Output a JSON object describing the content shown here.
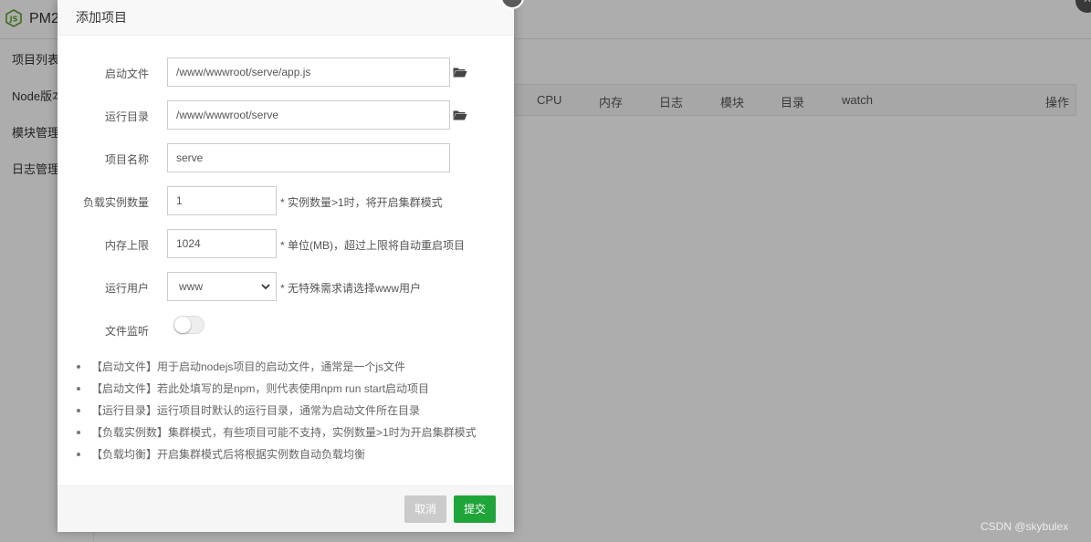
{
  "background": {
    "app_title": "PM2",
    "close_glyph": "×",
    "sidebar": [
      "项目列表",
      "Node版本",
      "模块管理",
      "日志管理"
    ],
    "table_headers": [
      "CPU",
      "内存",
      "日志",
      "模块",
      "目录",
      "watch",
      "操作"
    ]
  },
  "modal": {
    "title": "添加项目",
    "close_glyph": "×",
    "fields": {
      "start_file": {
        "label": "启动文件",
        "value": "/www/wwwroot/serve/app.js"
      },
      "run_dir": {
        "label": "运行目录",
        "value": "/www/wwwroot/serve"
      },
      "project_name": {
        "label": "项目名称",
        "value": "serve"
      },
      "instances": {
        "label": "负载实例数量",
        "value": "1",
        "hint": "* 实例数量>1时，将开启集群模式"
      },
      "memory_limit": {
        "label": "内存上限",
        "value": "1024",
        "hint": "* 单位(MB)，超过上限将自动重启项目"
      },
      "run_user": {
        "label": "运行用户",
        "value": "www",
        "hint": "* 无特殊需求请选择www用户"
      },
      "file_watch": {
        "label": "文件监听",
        "enabled": false
      }
    },
    "notes": [
      "【启动文件】用于启动nodejs项目的启动文件，通常是一个js文件",
      "【启动文件】若此处填写的是npm，则代表使用npm run start启动项目",
      "【运行目录】运行项目时默认的运行目录，通常为启动文件所在目录",
      "【负载实例数】集群模式，有些项目可能不支持，实例数量>1时为开启集群模式",
      "【负载均衡】开启集群模式后将根据实例数自动负载均衡"
    ],
    "buttons": {
      "cancel": "取消",
      "submit": "提交"
    }
  },
  "watermark": "CSDN @skybulex",
  "colors": {
    "submit": "#20a53a",
    "cancel": "#cbcbcb",
    "overlay": "rgba(0,0,0,0.32)"
  },
  "icons": [
    "nodejs-logo-icon",
    "folder-icon",
    "close-icon",
    "chevron-down-icon"
  ]
}
